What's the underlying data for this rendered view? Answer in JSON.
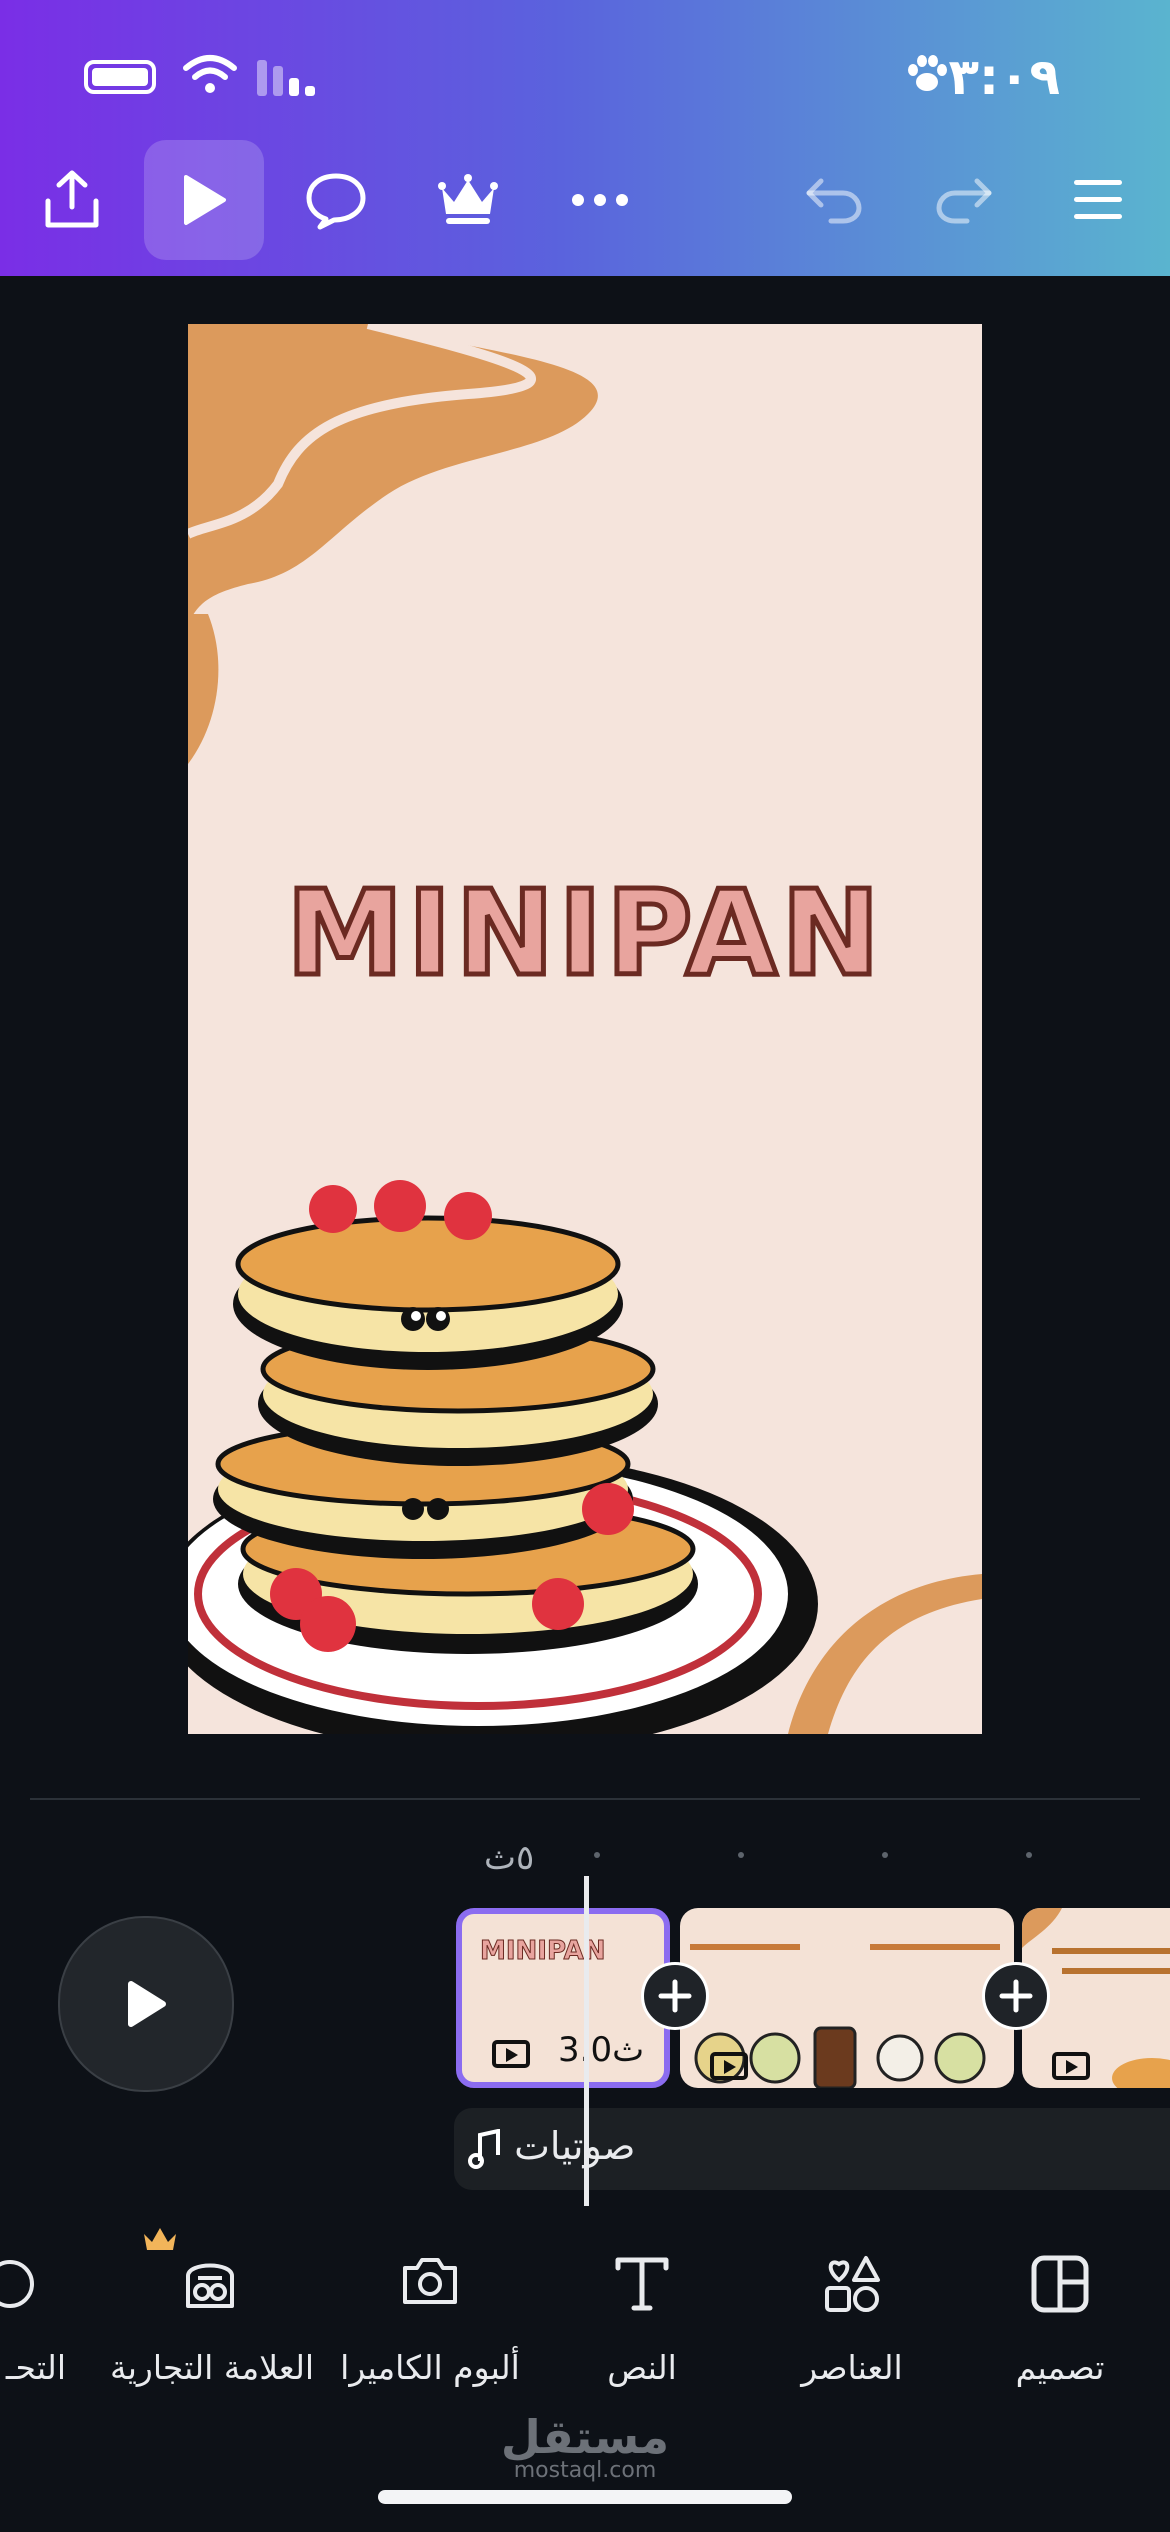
{
  "status_bar": {
    "time": "٣:٠٩"
  },
  "toolbar": {
    "share": "share-icon",
    "play": "play-icon",
    "comment": "comment-icon",
    "premium": "crown-icon",
    "more": "more-icon",
    "undo": "undo-icon",
    "redo": "redo-icon",
    "menu": "menu-icon"
  },
  "slide": {
    "title": "MINIPAN"
  },
  "timeline": {
    "time_marker": "٥ث",
    "clips": [
      {
        "label": "MINIPAN",
        "duration": "3.0ث",
        "selected": true
      },
      {
        "label": "",
        "duration": "",
        "selected": false
      },
      {
        "label": "",
        "duration": "",
        "selected": false
      }
    ],
    "audio_label": "صوتيات"
  },
  "bottom_nav": [
    {
      "label": "تصميم",
      "icon": "layout-icon"
    },
    {
      "label": "العناصر",
      "icon": "elements-icon"
    },
    {
      "label": "النص",
      "icon": "text-icon"
    },
    {
      "label": "ألبوم الكاميرا",
      "icon": "camera-icon"
    },
    {
      "label": "العلامة التجارية",
      "icon": "brand-icon",
      "premium": true
    },
    {
      "label": "التحـ",
      "icon": "edit-icon"
    }
  ],
  "watermark": {
    "main": "مستقل",
    "sub": "mostaql.com"
  },
  "colors": {
    "accent": "#8b6cf0",
    "bg": "#0d1117"
  }
}
